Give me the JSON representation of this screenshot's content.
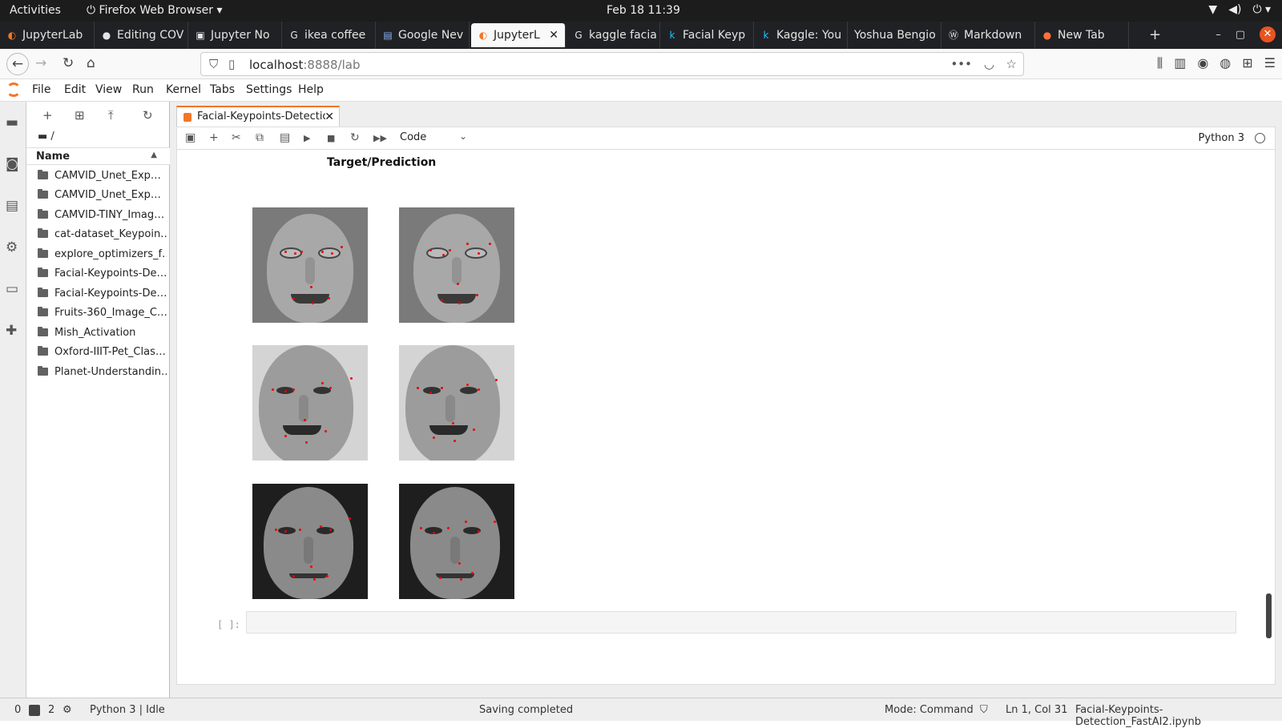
{
  "os": {
    "activities": "Activities",
    "app_name": "Firefox Web Browser",
    "clock": "Feb 18  11:39"
  },
  "browser": {
    "tabs": [
      {
        "label": "JupyterLab",
        "icon": "jupyter-icon"
      },
      {
        "label": "Editing COV",
        "icon": "github-icon"
      },
      {
        "label": "Jupyter No",
        "icon": "jupyter-notebook-icon"
      },
      {
        "label": "ikea coffee",
        "icon": "google-icon"
      },
      {
        "label": "Google Nev",
        "icon": "google-news-icon"
      },
      {
        "label": "JupyterL",
        "icon": "jupyter-icon"
      },
      {
        "label": "kaggle facia",
        "icon": "google-icon"
      },
      {
        "label": "Facial Keyp",
        "icon": "kaggle-icon"
      },
      {
        "label": "Kaggle: You",
        "icon": "kaggle-icon"
      },
      {
        "label": "Yoshua Bengio",
        "icon": ""
      },
      {
        "label": "Markdown",
        "icon": "wordpress-icon"
      },
      {
        "label": "New Tab",
        "icon": "firefox-icon"
      }
    ],
    "active_tab": 5,
    "url_host": "localhost",
    "url_rest": ":8888/lab"
  },
  "jupyter": {
    "menu": [
      "File",
      "Edit",
      "View",
      "Run",
      "Kernel",
      "Tabs",
      "Settings",
      "Help"
    ],
    "breadcrumb": "/",
    "file_header": "Name",
    "files": [
      "CAMVID_Unet_Exp…",
      "CAMVID_Unet_Exp…",
      "CAMVID-TINY_Imag…",
      "cat-dataset_Keypoin…",
      "explore_optimizers_f…",
      "Facial-Keypoints-De…",
      "Facial-Keypoints-De…",
      "Fruits-360_Image_C…",
      "Mish_Activation",
      "Oxford-IIIT-Pet_Clas…",
      "Planet-Understandin…"
    ],
    "doc_tab": "Facial-Keypoints-Detection_FastAI2.ipynb",
    "cell_type": "Code",
    "kernel": "Python 3",
    "output_title": "Target/Prediction",
    "empty_prompt": "[ ]:"
  },
  "status": {
    "zero": "0",
    "terminals": "2",
    "kernel_state": "Python 3 | Idle",
    "saving": "Saving completed",
    "mode": "Mode: Command",
    "position": "Ln 1, Col 31",
    "filename": "Facial-Keypoints-Detection_FastAI2.ipynb"
  }
}
